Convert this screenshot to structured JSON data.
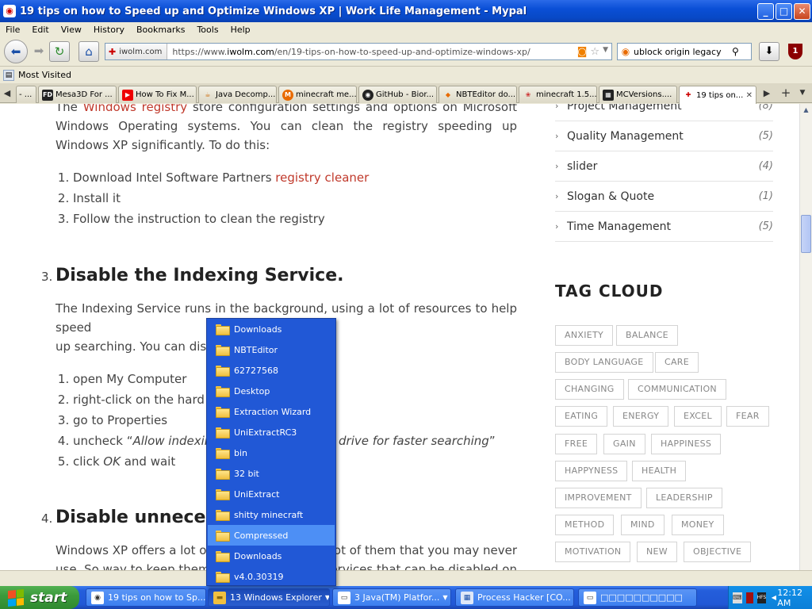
{
  "window": {
    "title": "19 tips on how to Speed up and Optimize Windows XP | Work Life Management - Mypal",
    "minimize": "_",
    "maximize": "□",
    "close": "✕"
  },
  "menu": [
    "File",
    "Edit",
    "View",
    "History",
    "Bookmarks",
    "Tools",
    "Help"
  ],
  "nav": {
    "identity": "iwolm.com",
    "url_prefix": "https://www.",
    "url_domain": "iwolm.com",
    "url_path": "/en/19-tips-on-how-to-speed-up-and-optimize-windows-xp/",
    "search_value": "ublock origin legacy",
    "ublock_count": "1"
  },
  "bookmarks": {
    "most_visited": "Most Visited"
  },
  "tabs": [
    {
      "label": "- ...",
      "icon": "blank"
    },
    {
      "label": "Mesa3D For ...",
      "icon": "FD"
    },
    {
      "label": "How To Fix M...",
      "icon": "youtube"
    },
    {
      "label": "Java Decomp...",
      "icon": "java"
    },
    {
      "label": "minecraft me...",
      "icon": "M"
    },
    {
      "label": "GitHub - Bior...",
      "icon": "github"
    },
    {
      "label": "NBTEditor do...",
      "icon": "N"
    },
    {
      "label": "minecraft 1.5...",
      "icon": "M"
    },
    {
      "label": "MCVersions....",
      "icon": "MC"
    },
    {
      "label": "19 tips on...",
      "icon": "iwolm"
    }
  ],
  "article": {
    "intro_pre": "The ",
    "intro_link": "Windows registry",
    "intro_post": " store configuration settings and options on Microsoft Windows Operating systems. You can clean the registry speeding up Windows XP significantly. To do this:",
    "steps1": [
      {
        "pre": "Download Intel Software Partners ",
        "link": "registry cleaner"
      },
      {
        "pre": "Install it",
        "link": ""
      },
      {
        "pre": "Follow the instruction to clean the registry",
        "link": ""
      }
    ],
    "h3_num": "3.",
    "h3_title": "Disable the Indexing Service.",
    "p3a": "The Indexing Service runs in the background, using a lot of resources to help speed",
    "p3b": "up searching. You can disab",
    "steps2": [
      {
        "a": "open My Computer",
        "b": "",
        "c": ""
      },
      {
        "a": "right-click on the hard dr",
        "b": "",
        "c": ""
      },
      {
        "a": "go to Properties",
        "b": "",
        "c": ""
      },
      {
        "a": "uncheck “",
        "b": "Allow indexing s",
        "c": ""
      },
      {
        "a": "click ",
        "b": "OK",
        "c": " and wait"
      }
    ],
    "step4_tail": "drive for faster searching",
    "step4_close": "”",
    "h4_num": "4.",
    "h4_title": "Disable unneces",
    "p4a_left": "Windows XP offers a lot of",
    "p4a_right": "a lot of them that you may never",
    "p4b_left": "use. So way to keep them?",
    "p4b_right": "services that can be disabled on"
  },
  "categories": [
    {
      "name": "Project Management",
      "count": "(8)"
    },
    {
      "name": "Quality Management",
      "count": "(5)"
    },
    {
      "name": "slider",
      "count": "(4)"
    },
    {
      "name": "Slogan & Quote",
      "count": "(1)"
    },
    {
      "name": "Time Management",
      "count": "(5)"
    }
  ],
  "tag_cloud_title": "TAG CLOUD",
  "tags": [
    [
      "ANXIETY",
      "BALANCE"
    ],
    [
      "BODY LANGUAGE",
      "CARE"
    ],
    [
      "CHANGING",
      "COMMUNICATION"
    ],
    [
      "EATING",
      "ENERGY",
      "EXCEL",
      "FEAR"
    ],
    [
      "FREE",
      "GAIN",
      "HAPPINESS"
    ],
    [
      "HAPPYNESS",
      "HEALTH"
    ],
    [
      "IMPROVEMENT",
      "LEADERSHIP"
    ],
    [
      "METHOD",
      "MIND",
      "MONEY"
    ],
    [
      "MOTIVATION",
      "NEW",
      "OBJECTIVE"
    ]
  ],
  "popup_items": [
    {
      "label": "Downloads",
      "highlight": false
    },
    {
      "label": "NBTEditor",
      "highlight": false
    },
    {
      "label": "62727568",
      "highlight": false
    },
    {
      "label": "Desktop",
      "highlight": false
    },
    {
      "label": "Extraction Wizard",
      "highlight": false
    },
    {
      "label": "UniExtractRC3",
      "highlight": false
    },
    {
      "label": "bin",
      "highlight": false
    },
    {
      "label": "32 bit",
      "highlight": false
    },
    {
      "label": "UniExtract",
      "highlight": false
    },
    {
      "label": "shitty minecraft",
      "highlight": false
    },
    {
      "label": "Compressed",
      "highlight": true
    },
    {
      "label": "Downloads",
      "highlight": false
    },
    {
      "label": "v4.0.30319",
      "highlight": false
    }
  ],
  "taskbar": {
    "start": "start",
    "tasks": [
      {
        "label": "19 tips on how to Sp...",
        "icon": "mypal"
      },
      {
        "label": "13 Windows Explorer",
        "icon": "folder",
        "pressed": true
      },
      {
        "label": "3 Java(TM) Platfor...",
        "icon": "java"
      },
      {
        "label": "Process Hacker [CO...",
        "icon": "ph"
      },
      {
        "label": "□□□□□□□□□□",
        "icon": "window"
      }
    ],
    "clock": "12:12 AM"
  }
}
